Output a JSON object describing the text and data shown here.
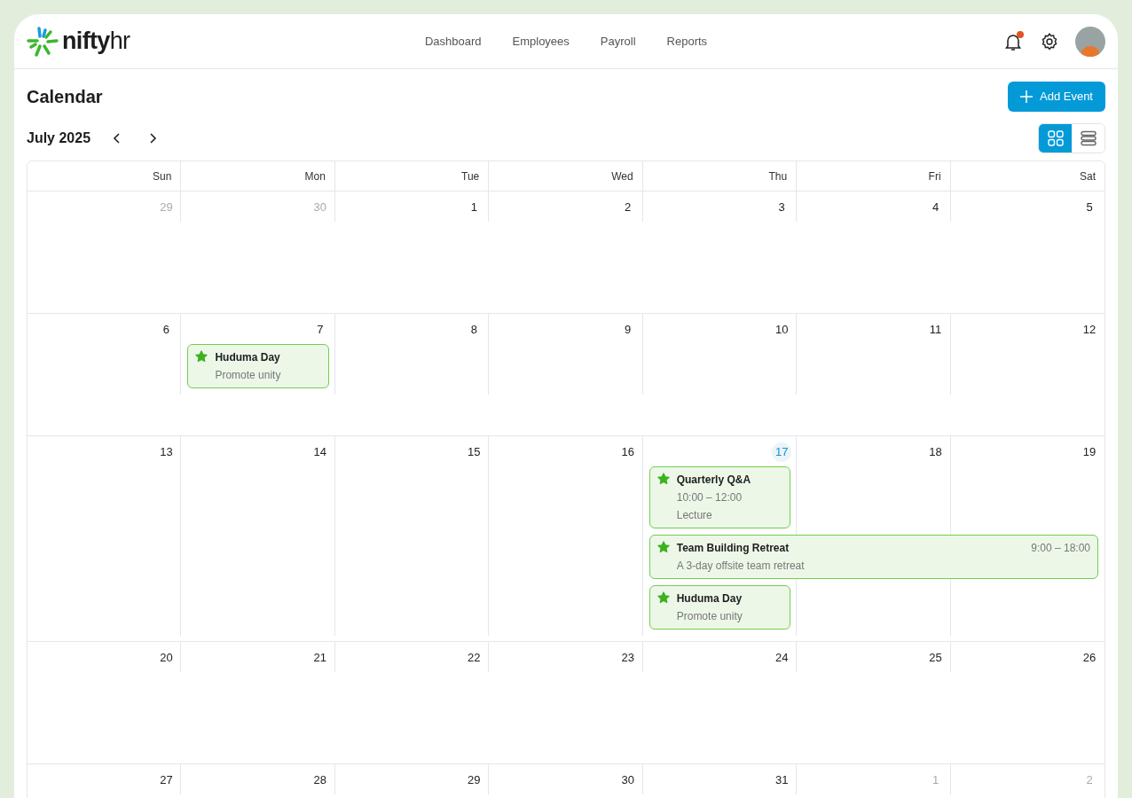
{
  "brand": {
    "part1": "nifty",
    "part2": "hr"
  },
  "nav": [
    {
      "label": "Dashboard",
      "selected": false
    },
    {
      "label": "Employees",
      "selected": false
    },
    {
      "label": "Payroll",
      "selected": false
    },
    {
      "label": "Reports",
      "selected": false
    }
  ],
  "notifications": {
    "unread": true
  },
  "page_title": "Calendar",
  "add_button": "Add Event",
  "month": "July 2025",
  "views": [
    {
      "kind": "grid",
      "selected": true
    },
    {
      "kind": "list",
      "selected": false
    }
  ],
  "weekdays": [
    "Sun",
    "Mon",
    "Tue",
    "Wed",
    "Thu",
    "Fri",
    "Sat"
  ],
  "weeks": [
    {
      "days": [
        {
          "label": "29",
          "muted": true,
          "today": false
        },
        {
          "label": "30",
          "muted": true,
          "today": false
        },
        {
          "label": "1",
          "muted": false,
          "today": false
        },
        {
          "label": "2",
          "muted": false,
          "today": false
        },
        {
          "label": "3",
          "muted": false,
          "today": false
        },
        {
          "label": "4",
          "muted": false,
          "today": false
        },
        {
          "label": "5",
          "muted": false,
          "today": false
        }
      ]
    },
    {
      "days": [
        {
          "label": "6",
          "muted": false,
          "today": false
        },
        {
          "label": "7",
          "muted": false,
          "today": false,
          "events": [
            {
              "kind": "single",
              "title": "Huduma Day",
              "lines": [
                "Promote unity"
              ]
            }
          ]
        },
        {
          "label": "8",
          "muted": false,
          "today": false
        },
        {
          "label": "9",
          "muted": false,
          "today": false
        },
        {
          "label": "10",
          "muted": false,
          "today": false
        },
        {
          "label": "11",
          "muted": false,
          "today": false
        },
        {
          "label": "12",
          "muted": false,
          "today": false
        }
      ]
    },
    {
      "days": [
        {
          "label": "13",
          "muted": false,
          "today": false
        },
        {
          "label": "14",
          "muted": false,
          "today": false
        },
        {
          "label": "15",
          "muted": false,
          "today": false
        },
        {
          "label": "16",
          "muted": false,
          "today": false
        },
        {
          "label": "17",
          "today": true,
          "events": [
            {
              "kind": "single",
              "title": "Quarterly Q&A",
              "lines": [
                "10:00 – 12:00",
                "Lecture"
              ]
            },
            {
              "kind": "multi-day",
              "title": "Team Building Retreat",
              "time": "9:00 – 18:00",
              "lines": [
                "A 3-day offsite team retreat"
              ]
            },
            {
              "kind": "single",
              "title": "Huduma Day",
              "lines": [
                "Promote unity"
              ]
            }
          ]
        },
        {
          "label": "18",
          "muted": false,
          "today": false
        },
        {
          "label": "19",
          "muted": false,
          "today": false
        }
      ]
    },
    {
      "days": [
        {
          "label": "20",
          "muted": false,
          "today": false
        },
        {
          "label": "21",
          "muted": false,
          "today": false
        },
        {
          "label": "22",
          "muted": false,
          "today": false
        },
        {
          "label": "23",
          "muted": false,
          "today": false
        },
        {
          "label": "24",
          "muted": false,
          "today": false
        },
        {
          "label": "25",
          "muted": false,
          "today": false
        },
        {
          "label": "26",
          "muted": false,
          "today": false
        }
      ]
    },
    {
      "days": [
        {
          "label": "27",
          "muted": false,
          "today": false
        },
        {
          "label": "28",
          "muted": false,
          "today": false
        },
        {
          "label": "29",
          "muted": false,
          "today": false
        },
        {
          "label": "30",
          "muted": false,
          "today": false
        },
        {
          "label": "31",
          "muted": false,
          "today": false
        },
        {
          "label": "1",
          "muted": true,
          "today": false
        },
        {
          "label": "2",
          "muted": true,
          "today": false
        }
      ]
    }
  ]
}
